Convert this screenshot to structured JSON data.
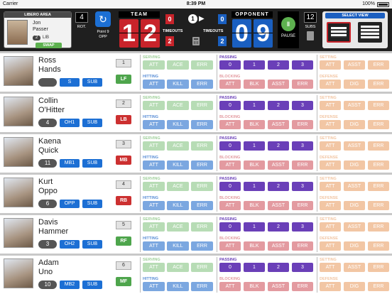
{
  "status": {
    "carrier": "Carrier",
    "time": "8:39 PM",
    "battery": "100%"
  },
  "libero": {
    "header": "LIBERO AREA",
    "first": "Jon",
    "last": "Passer",
    "number": "2",
    "position": "LIB",
    "swap_label": "SWAP"
  },
  "rotation": {
    "value": "4",
    "label": "ROT."
  },
  "serve": {
    "line1": "Point 9",
    "line2": "OPP",
    "icon": "serve-icon"
  },
  "team": {
    "label": "TEAM",
    "score_d1": "1",
    "score_d2": "2",
    "games": "0",
    "timeouts_label": "TIMEOUTS",
    "timeouts": "2"
  },
  "possession": "1",
  "opponent": {
    "label": "OPPONENT",
    "score_d1": "0",
    "score_d2": "9",
    "games": "0",
    "timeouts_label": "TIMEOUTS",
    "timeouts": "2"
  },
  "pause": {
    "label": "PAUSE"
  },
  "subs": {
    "value": "12",
    "label": "SUBS"
  },
  "select_view": {
    "label": "SELECT VIEW"
  },
  "sections": {
    "serving": "SERVING",
    "hitting": "HITTING",
    "passing": "PASSING",
    "blocking": "BLOCKING",
    "setting": "SETTING",
    "defense": "DEFENSE"
  },
  "buttons": {
    "serving": [
      "ATT",
      "ACE",
      "ERR"
    ],
    "hitting": [
      "ATT",
      "KILL",
      "ERR"
    ],
    "passing": [
      "0",
      "1",
      "2",
      "3"
    ],
    "blocking": [
      "ATT",
      "BLK",
      "ASST",
      "ERR"
    ],
    "setting": [
      "ATT",
      "ASST",
      "ERR"
    ],
    "defense": [
      "ATT",
      "DIG",
      "ERR"
    ]
  },
  "players": [
    {
      "first": "Ross",
      "last": "Hands",
      "number": "",
      "position": "S",
      "sub": "SUB",
      "rot": "1",
      "court": "LF",
      "court_color": "g"
    },
    {
      "first": "Collin",
      "last": "O'Hitter",
      "number": "4",
      "position": "OH1",
      "sub": "SUB",
      "rot": "2",
      "court": "LB",
      "court_color": "r"
    },
    {
      "first": "Kaena",
      "last": "Quick",
      "number": "11",
      "position": "MB1",
      "sub": "SUB",
      "rot": "3",
      "court": "MB",
      "court_color": "r"
    },
    {
      "first": "Kurt",
      "last": "Oppo",
      "number": "6",
      "position": "OPP",
      "sub": "SUB",
      "rot": "4",
      "court": "RB",
      "court_color": "r"
    },
    {
      "first": "Davis",
      "last": "Hammer",
      "number": "3",
      "position": "OH2",
      "sub": "SUB",
      "rot": "5",
      "court": "RF",
      "court_color": "g"
    },
    {
      "first": "Adam",
      "last": "Uno",
      "number": "10",
      "position": "MB2",
      "sub": "SUB",
      "rot": "6",
      "court": "MF",
      "court_color": "g"
    }
  ]
}
